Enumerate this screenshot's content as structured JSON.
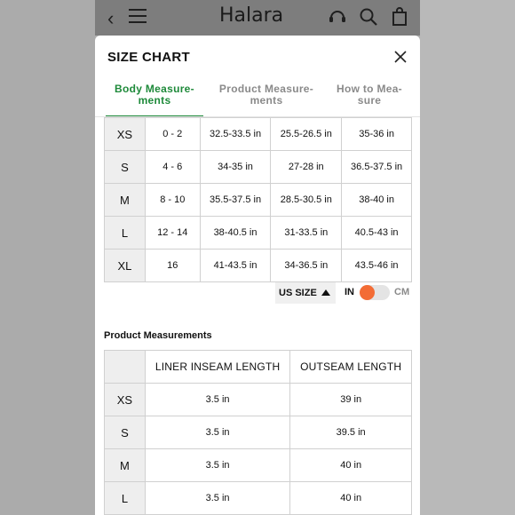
{
  "app": {
    "brand": "Halara"
  },
  "modal": {
    "title": "SIZE CHART"
  },
  "tabs": [
    {
      "line1": "Body Measure-",
      "line2": "ments"
    },
    {
      "line1": "Product Measure-",
      "line2": "ments"
    },
    {
      "line1": "How to Mea-",
      "line2": "sure"
    }
  ],
  "body_table": {
    "rows": [
      {
        "size": "XS",
        "us": "0 - 2",
        "c1": "32.5-33.5 in",
        "c2": "25.5-26.5 in",
        "c3": "35-36 in"
      },
      {
        "size": "S",
        "us": "4 - 6",
        "c1": "34-35 in",
        "c2": "27-28 in",
        "c3": "36.5-37.5 in"
      },
      {
        "size": "M",
        "us": "8 - 10",
        "c1": "35.5-37.5 in",
        "c2": "28.5-30.5 in",
        "c3": "38-40 in"
      },
      {
        "size": "L",
        "us": "12 - 14",
        "c1": "38-40.5 in",
        "c2": "31-33.5 in",
        "c3": "40.5-43 in"
      },
      {
        "size": "XL",
        "us": "16",
        "c1": "41-43.5 in",
        "c2": "34-36.5 in",
        "c3": "43.5-46 in"
      }
    ]
  },
  "units": {
    "size_selector": "US SIZE",
    "in_label": "IN",
    "cm_label": "CM",
    "selected": "IN"
  },
  "product_section": {
    "title": "Product Measurements",
    "headers": [
      "LINER INSEAM LENGTH",
      "OUTSEAM LENGTH"
    ],
    "rows": [
      {
        "size": "XS",
        "liner": "3.5 in",
        "outseam": "39 in"
      },
      {
        "size": "S",
        "liner": "3.5 in",
        "outseam": "39.5 in"
      },
      {
        "size": "M",
        "liner": "3.5 in",
        "outseam": "40 in"
      },
      {
        "size": "L",
        "liner": "3.5 in",
        "outseam": "40 in"
      }
    ]
  },
  "icons": {
    "back": "back-chevron-icon",
    "menu": "hamburger-menu-icon",
    "support": "headset-icon",
    "search": "search-icon",
    "bag": "shopping-bag-icon",
    "close": "close-icon",
    "sort": "triangle-up-icon"
  },
  "colors": {
    "accent_green": "#1e8a3a",
    "toggle_orange": "#f36c35"
  }
}
